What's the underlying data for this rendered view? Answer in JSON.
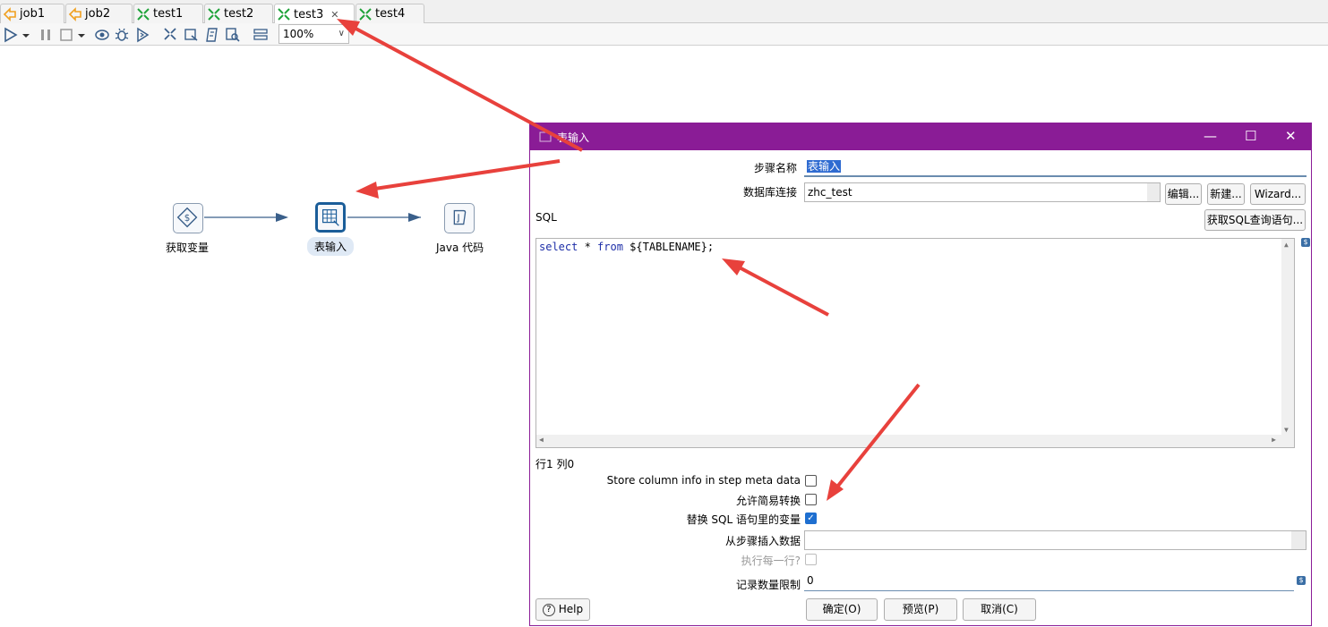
{
  "tabs": [
    {
      "label": "job1",
      "type": "job",
      "active": false
    },
    {
      "label": "job2",
      "type": "job",
      "active": false
    },
    {
      "label": "test1",
      "type": "transformation",
      "active": false
    },
    {
      "label": "test2",
      "type": "transformation",
      "active": false
    },
    {
      "label": "test3",
      "type": "transformation",
      "active": true
    },
    {
      "label": "test4",
      "type": "transformation",
      "active": false
    }
  ],
  "toolbar": {
    "icons": [
      "run-icon",
      "run-dropdown-icon",
      "pause-icon",
      "stop-icon",
      "stop-dropdown-icon",
      "preview-icon",
      "debug-icon",
      "replay-icon",
      "verify-icon",
      "impact-icon",
      "sql-icon",
      "explore-db-icon",
      "show-results-icon"
    ],
    "zoom": "100%"
  },
  "canvas": {
    "steps": [
      {
        "label": "获取变量",
        "icon": "get-variables-icon",
        "selected": false
      },
      {
        "label": "表输入",
        "icon": "table-input-icon",
        "selected": true
      },
      {
        "label": "Java 代码",
        "icon": "java-code-icon",
        "selected": false
      }
    ]
  },
  "dialog": {
    "title": "表输入",
    "step_name_label": "步骤名称",
    "step_name_value": "表输入",
    "db_conn_label": "数据库连接",
    "db_conn_value": "zhc_test",
    "edit_button": "编辑...",
    "new_button": "新建...",
    "wizard_button": "Wizard...",
    "sql_label": "SQL",
    "get_sql_button": "获取SQL查询语句...",
    "sql_code": {
      "kw1": "select",
      "star": " * ",
      "kw2": "from",
      "rest": " ${TABLENAME};"
    },
    "cursor_position": "行1 列0",
    "store_column_info_label": "Store column info in step meta data",
    "store_column_info_checked": false,
    "lazy_conversion_label": "允许简易转换",
    "lazy_conversion_checked": false,
    "replace_variables_label": "替换 SQL 语句里的变量",
    "replace_variables_checked": true,
    "insert_from_step_label": "从步骤插入数据",
    "insert_from_step_value": "",
    "execute_each_row_label": "执行每一行?",
    "execute_each_row_checked": false,
    "limit_label": "记录数量限制",
    "limit_value": "0",
    "help_button": "Help",
    "ok_button": "确定(O)",
    "preview_button": "预览(P)",
    "cancel_button": "取消(C)"
  },
  "colors": {
    "dialog_title_bg": "#8a1c96",
    "arrow": "#e8413c",
    "selected_step_border": "#1a5d99"
  }
}
